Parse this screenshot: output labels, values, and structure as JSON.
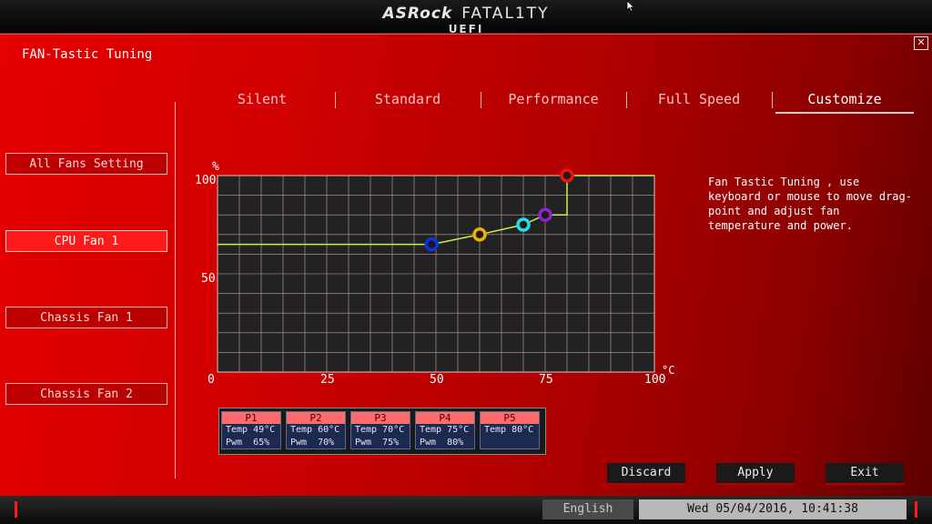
{
  "header": {
    "brand_main": "ASRock",
    "brand_sub": "FATAL1TY",
    "brand_uefi": "UEFI"
  },
  "page": {
    "title": "FAN-Tastic Tuning",
    "close_label": "✕"
  },
  "sidebar": {
    "items": [
      {
        "label": "All Fans Setting",
        "active": false
      },
      {
        "label": "CPU Fan 1",
        "active": true
      },
      {
        "label": "Chassis Fan 1",
        "active": false
      },
      {
        "label": "Chassis Fan 2",
        "active": false
      }
    ]
  },
  "tabs": [
    {
      "label": "Silent"
    },
    {
      "label": "Standard"
    },
    {
      "label": "Performance"
    },
    {
      "label": "Full Speed"
    },
    {
      "label": "Customize",
      "active": true
    }
  ],
  "help": "Fan Tastic Tuning , use keyboard or mouse to move drag-point and adjust fan temperature and power.",
  "chart_data": {
    "type": "line",
    "xlabel": "°C",
    "ylabel": "%",
    "xlim": [
      0,
      100
    ],
    "ylim": [
      0,
      100
    ],
    "x_ticks": [
      0,
      25,
      50,
      75,
      100
    ],
    "y_ticks": [
      50,
      100
    ],
    "grid": true,
    "line_color": "#c8f050",
    "curve": [
      [
        0,
        65
      ],
      [
        49,
        65
      ],
      [
        60,
        70
      ],
      [
        70,
        75
      ],
      [
        75,
        80
      ],
      [
        80,
        80
      ],
      [
        80,
        100
      ],
      [
        100,
        100
      ]
    ],
    "points": [
      {
        "name": "P1",
        "temp": 49,
        "pwm": 65,
        "color": "#1030e0"
      },
      {
        "name": "P2",
        "temp": 60,
        "pwm": 70,
        "color": "#f0b000"
      },
      {
        "name": "P3",
        "temp": 70,
        "pwm": 75,
        "color": "#20e0f0"
      },
      {
        "name": "P4",
        "temp": 75,
        "pwm": 80,
        "color": "#9020d0"
      },
      {
        "name": "P5",
        "temp": 80,
        "pwm": 100,
        "color": "#ee1010"
      }
    ]
  },
  "point_cards": [
    {
      "label": "P1",
      "temp": "Temp 49°C",
      "pwm": "Pwm  65%"
    },
    {
      "label": "P2",
      "temp": "Temp 60°C",
      "pwm": "Pwm  70%"
    },
    {
      "label": "P3",
      "temp": "Temp 70°C",
      "pwm": "Pwm  75%"
    },
    {
      "label": "P4",
      "temp": "Temp 75°C",
      "pwm": "Pwm  80%"
    },
    {
      "label": "P5",
      "temp": "Temp 80°C",
      "pwm": ""
    }
  ],
  "buttons": {
    "discard": "Discard",
    "apply": "Apply",
    "exit": "Exit"
  },
  "footer": {
    "language": "English",
    "datetime": "Wed 05/04/2016, 10:41:38"
  },
  "colors": {
    "panel_red": "#cf0000",
    "active_red": "#ff1a1a",
    "card_blue": "#1c2a52",
    "card_header": "#ff6b6b"
  }
}
